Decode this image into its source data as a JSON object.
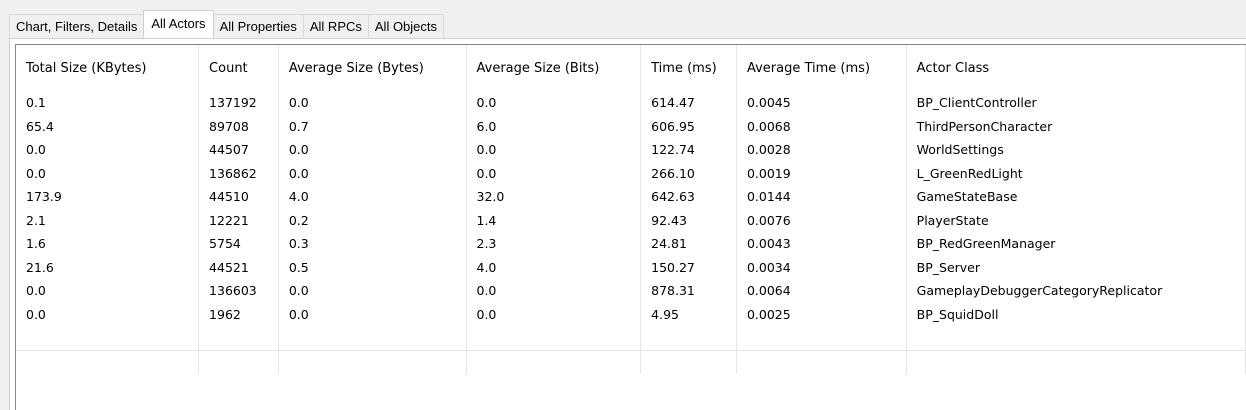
{
  "tabs": [
    {
      "label": "Chart, Filters, Details",
      "active": false
    },
    {
      "label": "All Actors",
      "active": true
    },
    {
      "label": "All Properties",
      "active": false
    },
    {
      "label": "All RPCs",
      "active": false
    },
    {
      "label": "All Objects",
      "active": false
    }
  ],
  "table": {
    "columns": [
      "Total Size (KBytes)",
      "Count",
      "Average Size (Bytes)",
      "Average Size (Bits)",
      "Time (ms)",
      "Average Time (ms)",
      "Actor Class"
    ],
    "rows": [
      [
        "0.1",
        "137192",
        "0.0",
        "0.0",
        "614.47",
        "0.0045",
        "BP_ClientController"
      ],
      [
        "65.4",
        "89708",
        "0.7",
        "6.0",
        "606.95",
        "0.0068",
        "ThirdPersonCharacter"
      ],
      [
        "0.0",
        "44507",
        "0.0",
        "0.0",
        "122.74",
        "0.0028",
        "WorldSettings"
      ],
      [
        "0.0",
        "136862",
        "0.0",
        "0.0",
        "266.10",
        "0.0019",
        "L_GreenRedLight"
      ],
      [
        "173.9",
        "44510",
        "4.0",
        "32.0",
        "642.63",
        "0.0144",
        "GameStateBase"
      ],
      [
        "2.1",
        "12221",
        "0.2",
        "1.4",
        "92.43",
        "0.0076",
        "PlayerState"
      ],
      [
        "1.6",
        "5754",
        "0.3",
        "2.3",
        "24.81",
        "0.0043",
        "BP_RedGreenManager"
      ],
      [
        "21.6",
        "44521",
        "0.5",
        "4.0",
        "150.27",
        "0.0034",
        "BP_Server"
      ],
      [
        "0.0",
        "136603",
        "0.0",
        "0.0",
        "878.31",
        "0.0064",
        "GameplayDebuggerCategoryReplicator"
      ],
      [
        "0.0",
        "1962",
        "0.0",
        "0.0",
        "4.95",
        "0.0025",
        "BP_SquidDoll"
      ]
    ]
  },
  "colors": {
    "background": "#f0f0f0",
    "panel": "#ffffff",
    "grid": "#e5e5e5",
    "border": "#828790"
  }
}
